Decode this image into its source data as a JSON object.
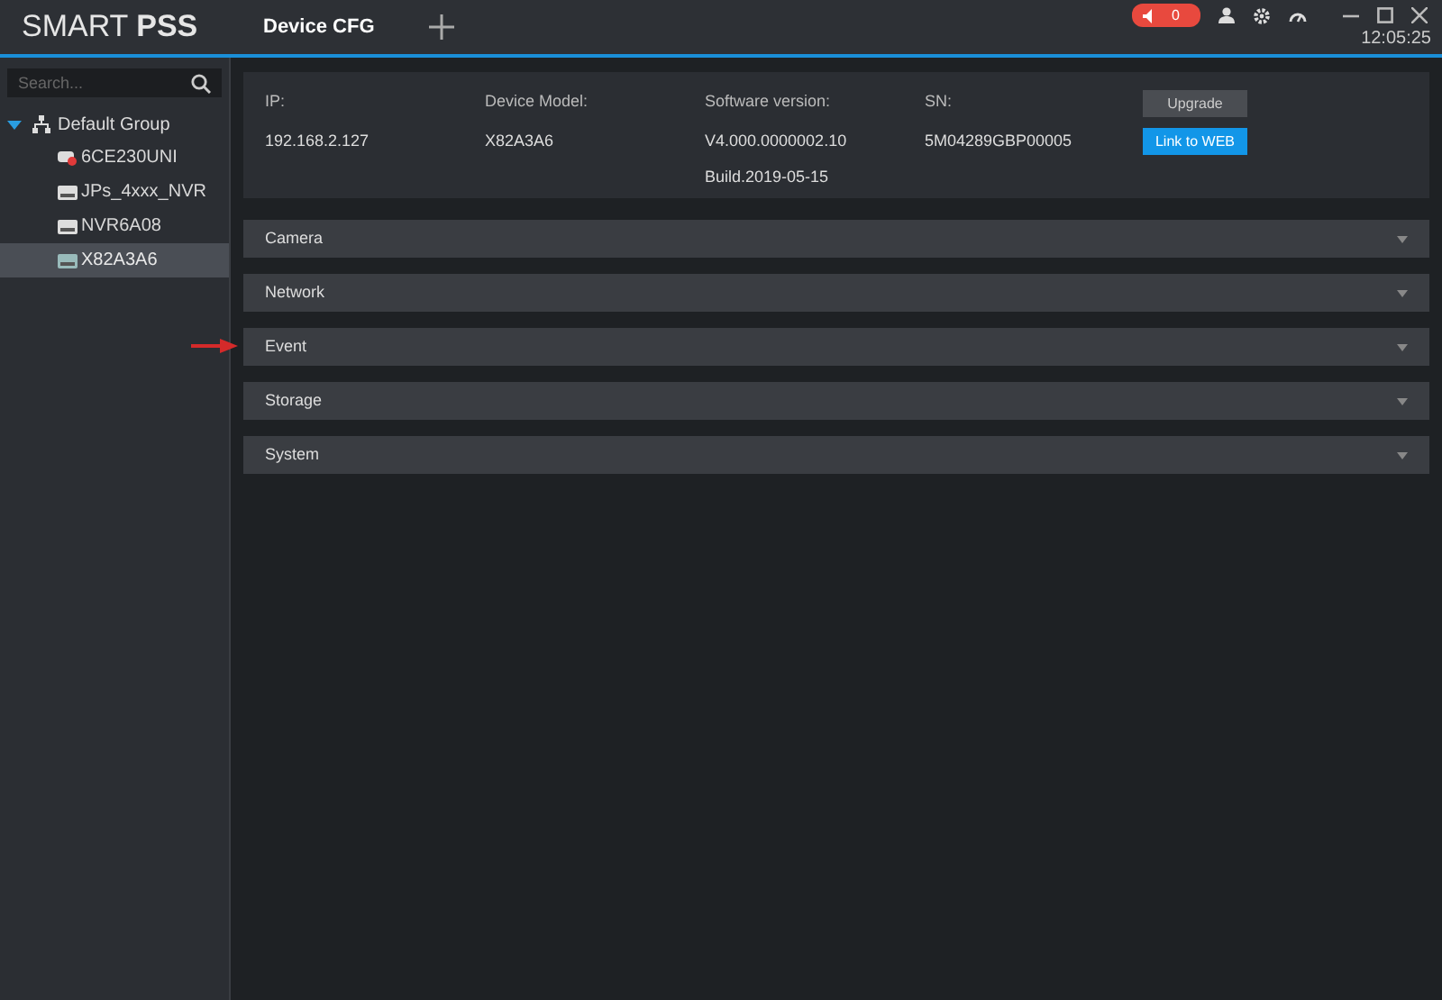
{
  "app": {
    "logo": "SMART **PSS**",
    "time": "12:05:25",
    "alarm_count": "0"
  },
  "tabs": [
    {
      "label": "Device CFG",
      "selected": true
    }
  ],
  "search": {
    "placeholder": "Search..."
  },
  "tree": {
    "label": "Default Group",
    "expanded": true,
    "children": [
      {
        "label": "6CE230UNI",
        "kind": "camera",
        "selected": false
      },
      {
        "label": "JPs_4xxx_NVR",
        "kind": "recorder",
        "selected": false
      },
      {
        "label": "NVR6A08",
        "kind": "recorder",
        "selected": false
      },
      {
        "label": "X82A3A6",
        "kind": "recorder",
        "selected": true
      }
    ]
  },
  "device_info": {
    "fields": [
      {
        "label": "IP:",
        "values": [
          "192.168.2.127"
        ]
      },
      {
        "label": "Device Model:",
        "values": [
          "X82A3A6"
        ]
      },
      {
        "label": "Software version:",
        "values": [
          "V4.000.0000002.10",
          "Build.2019-05-15"
        ]
      },
      {
        "label": "SN:",
        "values": [
          "5M04289GBP00005"
        ]
      }
    ],
    "buttons": [
      {
        "label": "Upgrade",
        "kind": "secondary"
      },
      {
        "label": "Link to WEB",
        "kind": "primary"
      }
    ]
  },
  "sections": [
    {
      "label": "Camera",
      "pointed": false
    },
    {
      "label": "Network",
      "pointed": false
    },
    {
      "label": "Event",
      "pointed": true
    },
    {
      "label": "Storage",
      "pointed": false
    },
    {
      "label": "System",
      "pointed": false
    }
  ]
}
